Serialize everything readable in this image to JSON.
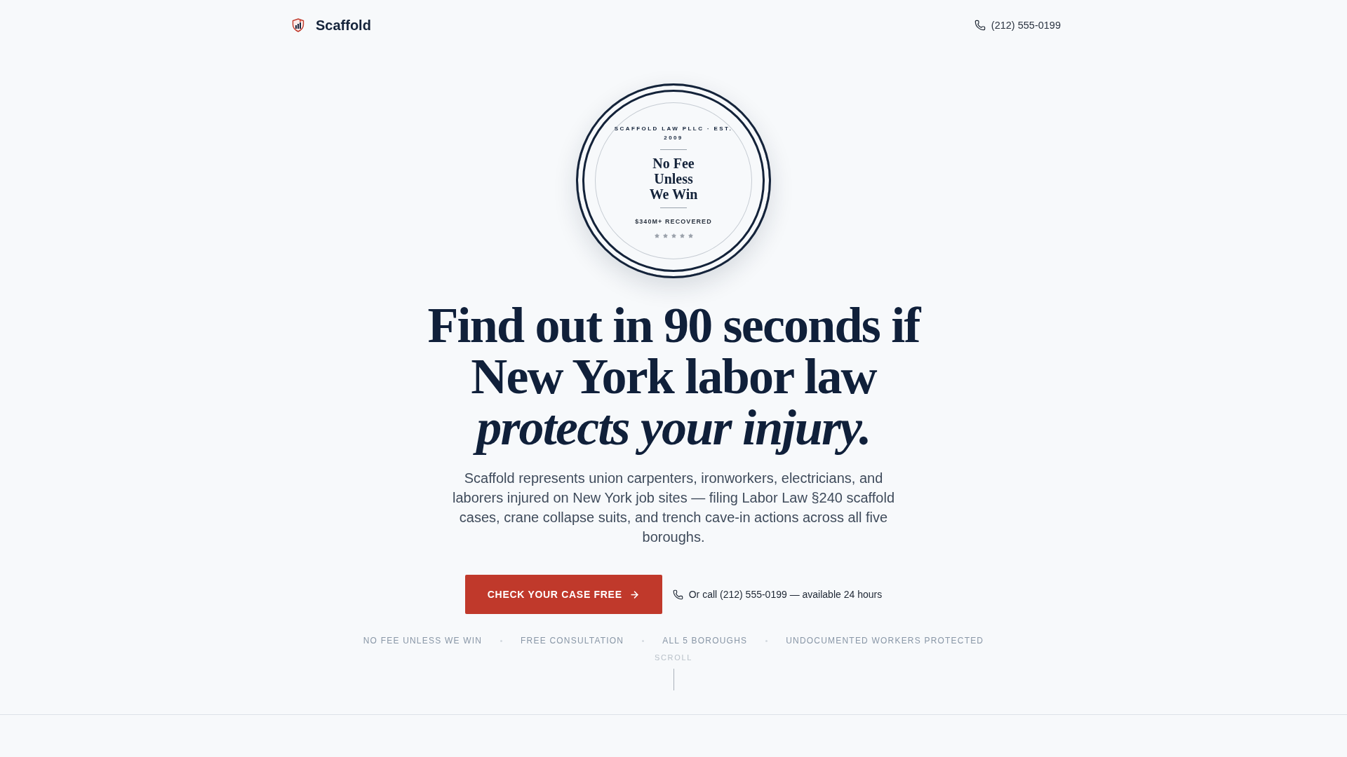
{
  "header": {
    "brand": "Scaffold",
    "phone": "(212) 555-0199"
  },
  "badge": {
    "firm": "SCAFFOLD LAW PLLC · EST. 2009",
    "title": "No Fee Unless We Win",
    "stat": "$340M+ RECOVERED",
    "stars": 5
  },
  "hero": {
    "headline": "Find out in 90 seconds if New York labor law *protects your injury.*",
    "description": "Scaffold represents union carpenters, ironworkers, electricians, and laborers injured on New York job sites — filing Labor Law §240 scaffold cases, crane collapse suits, and trench cave-in actions across all five boroughs.",
    "cta": "CHECK YOUR CASE FREE",
    "call_note": "Or call (212) 555-0199 — available 24 hours"
  },
  "trust_points": [
    "NO FEE UNLESS WE WIN",
    "FREE CONSULTATION",
    "ALL 5 BOROUGHS",
    "UNDOCUMENTED WORKERS PROTECTED"
  ],
  "scroll_hint": "SCROLL"
}
